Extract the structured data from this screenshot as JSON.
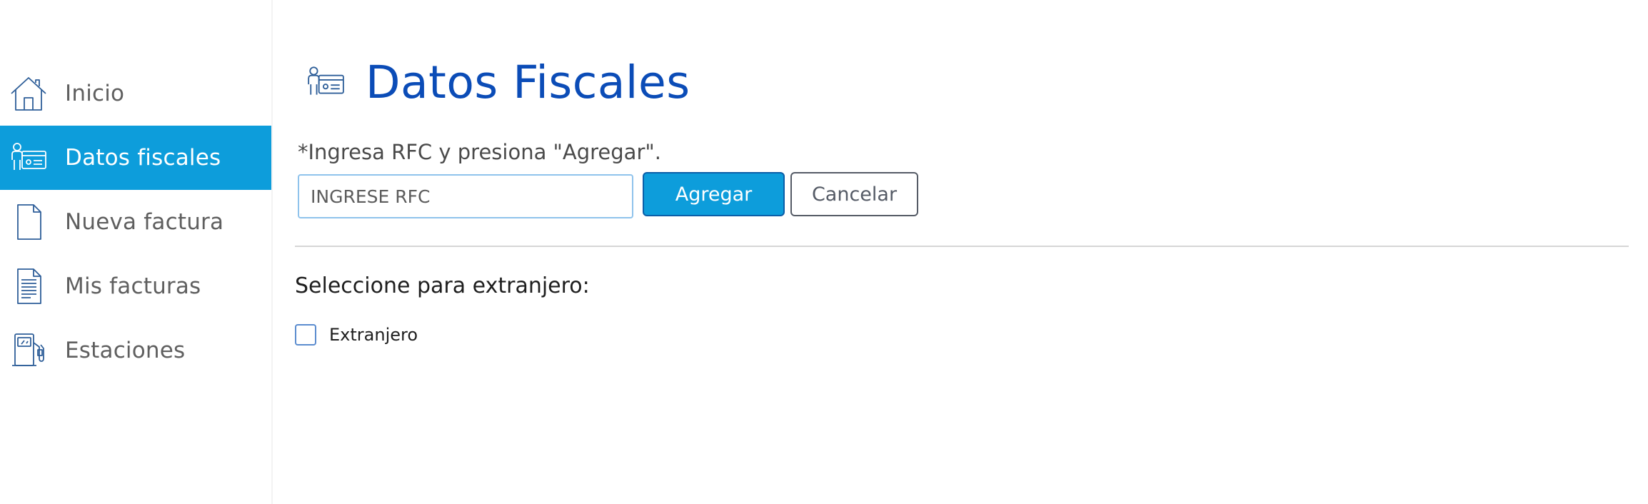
{
  "sidebar": {
    "items": [
      {
        "label": "Inicio",
        "icon": "home-icon",
        "active": false
      },
      {
        "label": "Datos fiscales",
        "icon": "id-card-icon",
        "active": true
      },
      {
        "label": "Nueva factura",
        "icon": "blank-document-icon",
        "active": false
      },
      {
        "label": "Mis facturas",
        "icon": "document-lines-icon",
        "active": false
      },
      {
        "label": "Estaciones",
        "icon": "fuel-station-icon",
        "active": false
      }
    ]
  },
  "main": {
    "title": "Datos Fiscales",
    "title_icon": "id-card-icon",
    "instruction": "*Ingresa RFC y presiona \"Agregar\".",
    "rfc_input": {
      "value": "",
      "placeholder": "INGRESE RFC"
    },
    "add_button_label": "Agregar",
    "cancel_button_label": "Cancelar",
    "foreign_section_label": "Seleccione para extranjero:",
    "foreign_checkbox": {
      "label": "Extranjero",
      "checked": false
    }
  },
  "colors": {
    "accent": "#0d9ddb",
    "title": "#0b4cb7",
    "nav_text": "#5f5f5f",
    "icon_stroke": "#2f5f99"
  }
}
